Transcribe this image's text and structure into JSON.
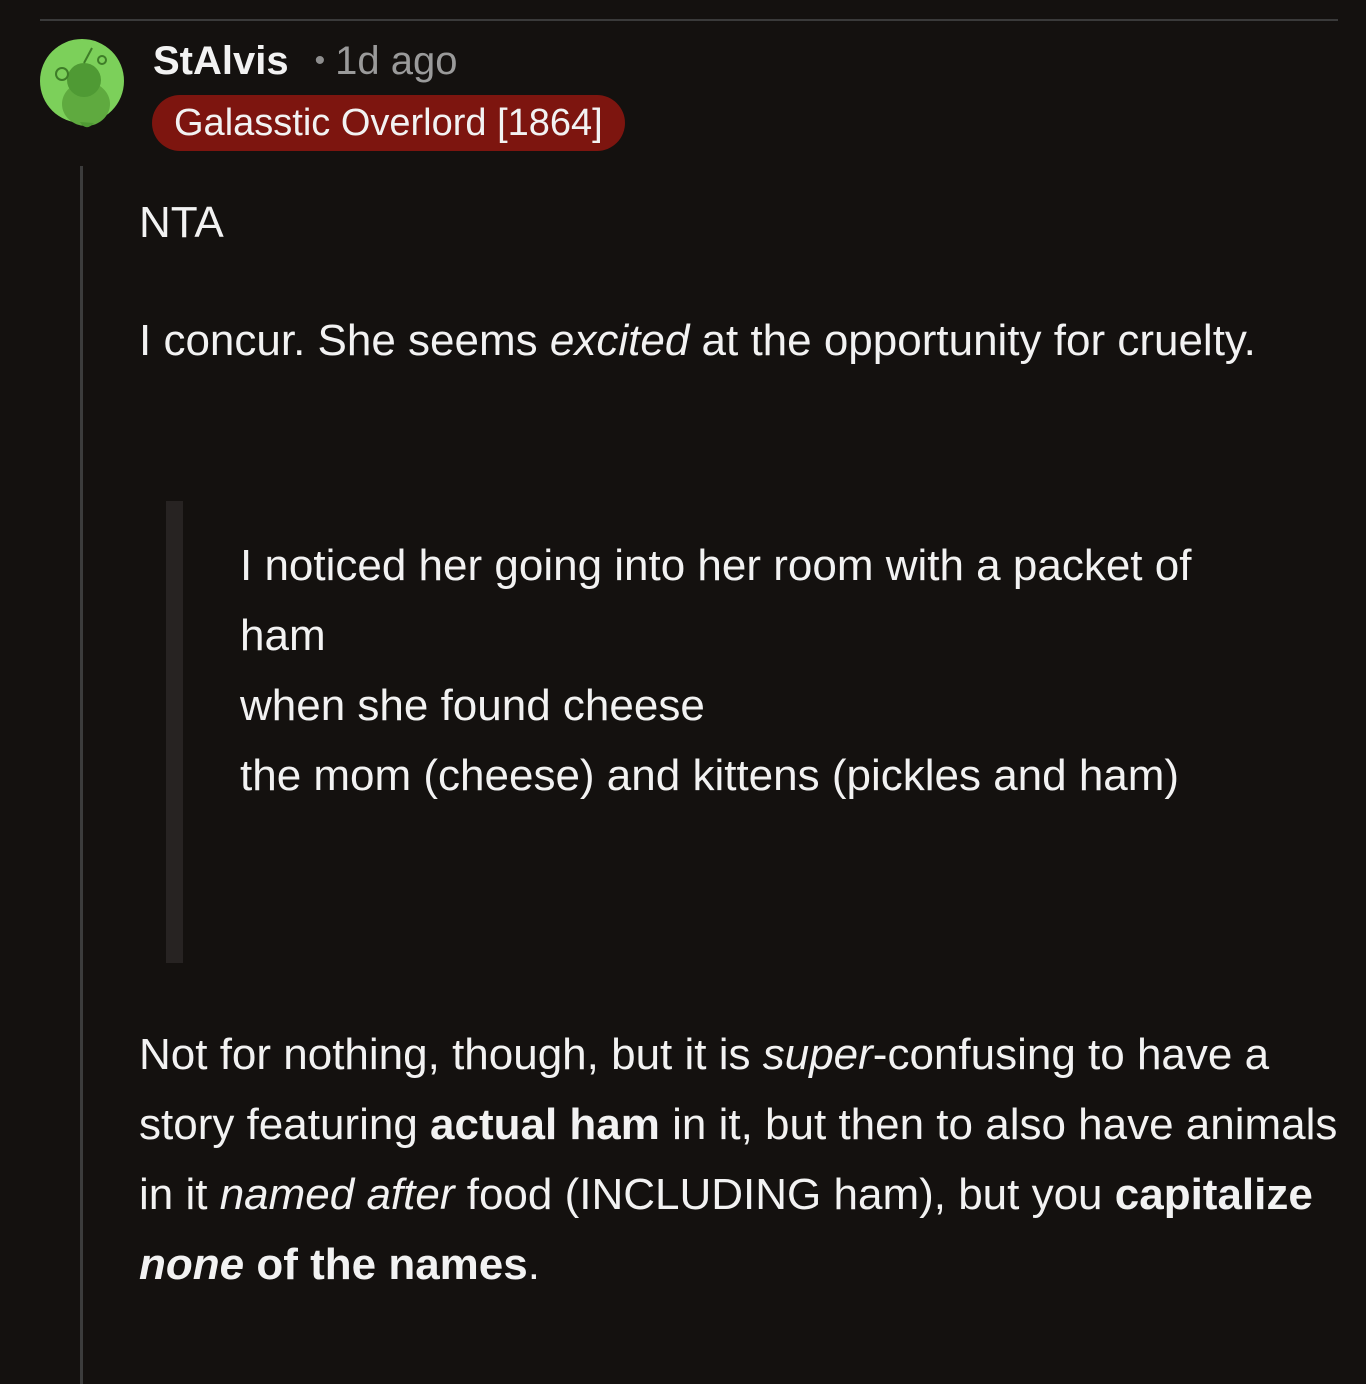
{
  "comment": {
    "username": "StAlvis",
    "separator": "•",
    "timestamp": "1d ago",
    "flair": "Galasstic Overlord [1864]",
    "flair_color": "#7d150f",
    "avatar_icon": "snoo-avatar-icon",
    "avatar_color": "#7cd05a",
    "body": {
      "line1": "NTA",
      "concur": {
        "a": "I concur. She seems ",
        "b_italic": "excited",
        "c": " at the opportunity for cruelty."
      },
      "quote": {
        "q1": "I noticed her going into her room with a packet of ham",
        "q2": "when she found cheese",
        "q3": "the mom (cheese) and kittens (pickles and ham)"
      },
      "last": {
        "a": "Not for nothing, though, but it is ",
        "b_italic": "super",
        "c": "-confusing to have a story featuring ",
        "d_bold": "actual ham",
        "e": " in it, but then to also have animals in it ",
        "f_italic": "named after",
        "g": " food (INCLUDING ham), but you ",
        "h_bold": "capitalize ",
        "i_bold_italic": "none",
        "j_bold": " of the names",
        "k": "."
      }
    }
  }
}
